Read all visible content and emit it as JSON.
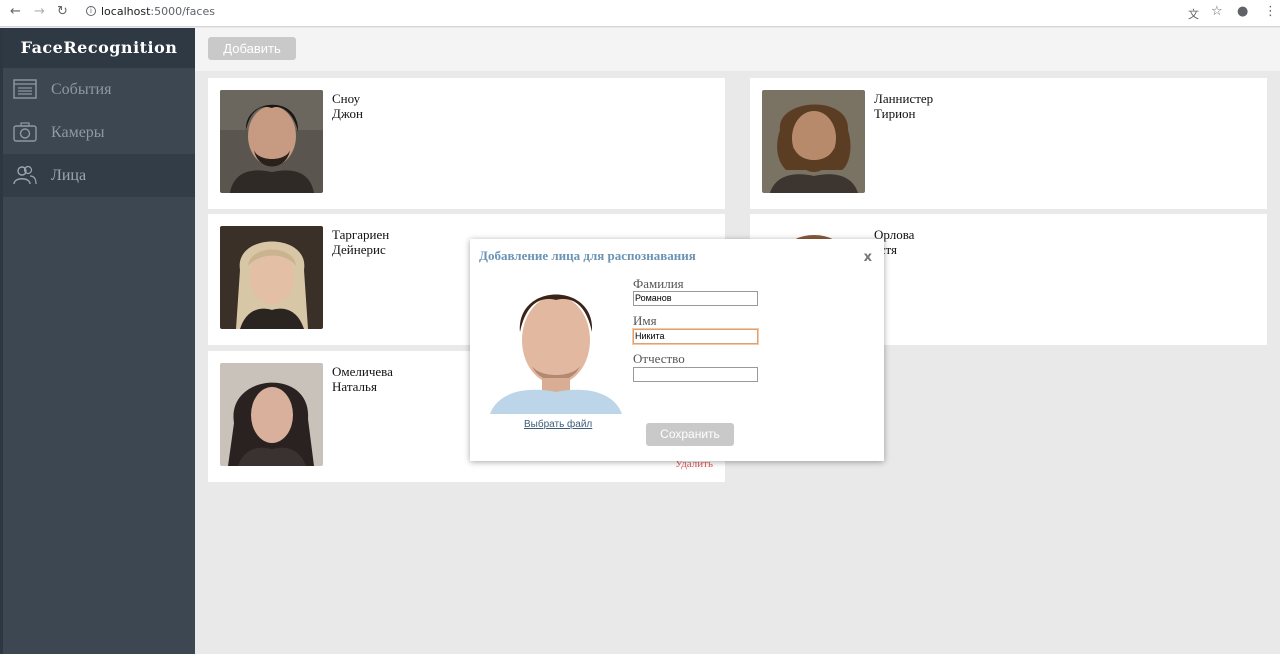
{
  "browser": {
    "url_host": "localhost",
    "url_rest": ":5000/faces"
  },
  "sidebar": {
    "brand": "FaceRecognition",
    "items": [
      {
        "label": "События",
        "icon": "list-icon"
      },
      {
        "label": "Камеры",
        "icon": "camera-icon"
      },
      {
        "label": "Лица",
        "icon": "people-icon",
        "active": true
      }
    ]
  },
  "toolbar": {
    "add_label": "Добавить"
  },
  "faces": [
    {
      "surname": "Сноу",
      "name": "Джон"
    },
    {
      "surname": "Ланнистер",
      "name": "Тирион"
    },
    {
      "surname": "Таргариен",
      "name": "Дейнерис"
    },
    {
      "surname": "Орлова",
      "name": "астя"
    },
    {
      "surname": "Омеличева",
      "name": "Наталья",
      "delete_label": "Удалить"
    }
  ],
  "dialog": {
    "title": "Добавление лица для распознавания",
    "close_label": "x",
    "choose_file": "Выбрать файл",
    "fields": {
      "surname_label": "Фамилия",
      "surname_value": "Романов",
      "name_label": "Имя",
      "name_value": "Никита",
      "patronymic_label": "Отчество",
      "patronymic_value": ""
    },
    "save_label": "Сохранить"
  }
}
